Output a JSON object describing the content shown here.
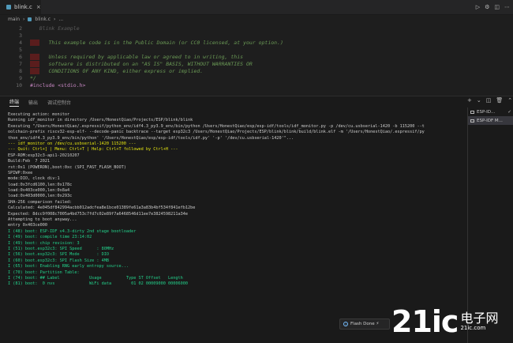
{
  "tabs": [
    {
      "label": "blink.c",
      "active": true
    }
  ],
  "breadcrumb": [
    "main",
    "C",
    "blink.c",
    "..."
  ],
  "editor": {
    "lines": [
      {
        "num": "2",
        "text": "   Blink Example",
        "style": "dim"
      },
      {
        "num": "3",
        "text": "",
        "style": "dim"
      },
      {
        "num": "4",
        "text": "   This example code is in the Public Domain (or CC0 licensed, at your option.)",
        "style": "comment"
      },
      {
        "num": "5",
        "text": "",
        "style": "comment"
      },
      {
        "num": "6",
        "text": "   Unless required by applicable law or agreed to in writing, this",
        "style": "comment"
      },
      {
        "num": "7",
        "text": "   software is distributed on an \"AS IS\" BASIS, WITHOUT WARRANTIES OR",
        "style": "comment"
      },
      {
        "num": "8",
        "text": "   CONDITIONS OF ANY KIND, either express or implied.",
        "style": "comment"
      },
      {
        "num": "9",
        "text": "*/",
        "style": "comment"
      },
      {
        "num": "10",
        "text": "#include <stdio.h>",
        "style": "include"
      }
    ]
  },
  "panel": {
    "tabs": [
      "终端",
      "输出",
      "调试控制台"
    ],
    "terminals": [
      "ESP-ID...",
      "ESP-IDF M..."
    ],
    "lines": [
      {
        "t": "Executing action: monitor",
        "c": ""
      },
      {
        "t": "Running idf_monitor in directory /Users/HonestQiao/Projects/ESP/blink/blink",
        "c": ""
      },
      {
        "t": "Executing \"/Users/HonestQiao/.espressif/python_env/idf4.3_py3.9_env/bin/python /Users/HonestQiao/esp/esp-idf/tools/idf_monitor.py -p /dev/cu.usbserial-1420 -b 115200 --t",
        "c": ""
      },
      {
        "t": "oolchain-prefix riscv32-esp-elf- --decode-panic backtrace --target esp32c3 /Users/HonestQiao/Projects/ESP/blink/blink/build/blink.elf -m '/Users/HonestQiao/.espressif/py",
        "c": ""
      },
      {
        "t": "thon_env/idf4.3_py3.9_env/bin/python' '/Users/HonestQiao/esp/esp-idf/tools/idf.py' '-p' '/dev/cu.usbserial-1420'\"...",
        "c": ""
      },
      {
        "t": "--- idf_monitor on /dev/cu.usbserial-1420 115200 ---",
        "c": "yellow"
      },
      {
        "t": "--- Quit: Ctrl+] | Menu: Ctrl+T | Help: Ctrl+T followed by Ctrl+H ---",
        "c": "yellow"
      },
      {
        "t": "ESP-ROM:esp32c3-api1-20210207",
        "c": ""
      },
      {
        "t": "Build:Feb  7 2021",
        "c": ""
      },
      {
        "t": "rst:0x1 (POWERON),boot:0xc (SPI_FAST_FLASH_BOOT)",
        "c": ""
      },
      {
        "t": "SPIWP:0xee",
        "c": ""
      },
      {
        "t": "mode:DIO, clock div:1",
        "c": ""
      },
      {
        "t": "load:0x3fcd6100,len:0x178c",
        "c": ""
      },
      {
        "t": "load:0x403ce000,len:0x8a4",
        "c": ""
      },
      {
        "t": "load:0x403d0000,len:0x293c",
        "c": ""
      },
      {
        "t": "SHA-256 comparison failed:",
        "c": ""
      },
      {
        "t": "Calculated: 4e045df842994acbb012adcfea8e1bce01389fe61a3a83b4bf534f841efb12be",
        "c": ""
      },
      {
        "t": "Expected: 8dcc9f008c7005a4bd753c7fd7c02e89f7a6468546d11ee7e3824598211a34e",
        "c": ""
      },
      {
        "t": "Attempting to boot anyway...",
        "c": ""
      },
      {
        "t": "entry 0x403ce000",
        "c": ""
      },
      {
        "t": "I (48) boot: ESP-IDF v4.3-dirty 2nd stage bootloader",
        "c": "green"
      },
      {
        "t": "I (49) boot: compile time 23:14:02",
        "c": "green"
      },
      {
        "t": "I (49) boot: chip revision: 3",
        "c": "green"
      },
      {
        "t": "I (51) boot.esp32c3: SPI Speed      : 80MHz",
        "c": "green"
      },
      {
        "t": "I (56) boot.esp32c3: SPI Mode       : DIO",
        "c": "green"
      },
      {
        "t": "I (60) boot.esp32c3: SPI Flash Size : 4MB",
        "c": "green"
      },
      {
        "t": "I (65) boot: Enabling RNG early entropy source...",
        "c": "green"
      },
      {
        "t": "I (70) boot: Partition Table:",
        "c": "green"
      },
      {
        "t": "I (74) boot: ## Label            Usage          Type ST Offset   Length",
        "c": "green"
      },
      {
        "t": "I (81) boot:  0 nvs              WiFi data        01 02 00009000 00006000",
        "c": "green"
      }
    ]
  },
  "toast": {
    "label": "Flash Done ⚡"
  },
  "watermark": {
    "big": "21ic",
    "cn": "电子网",
    "domain": "21ic.com"
  },
  "colors": {
    "comment": "#6a9955",
    "highlight": "#5a1d1d",
    "yellow": "#e5e510",
    "green": "#23d18b"
  }
}
